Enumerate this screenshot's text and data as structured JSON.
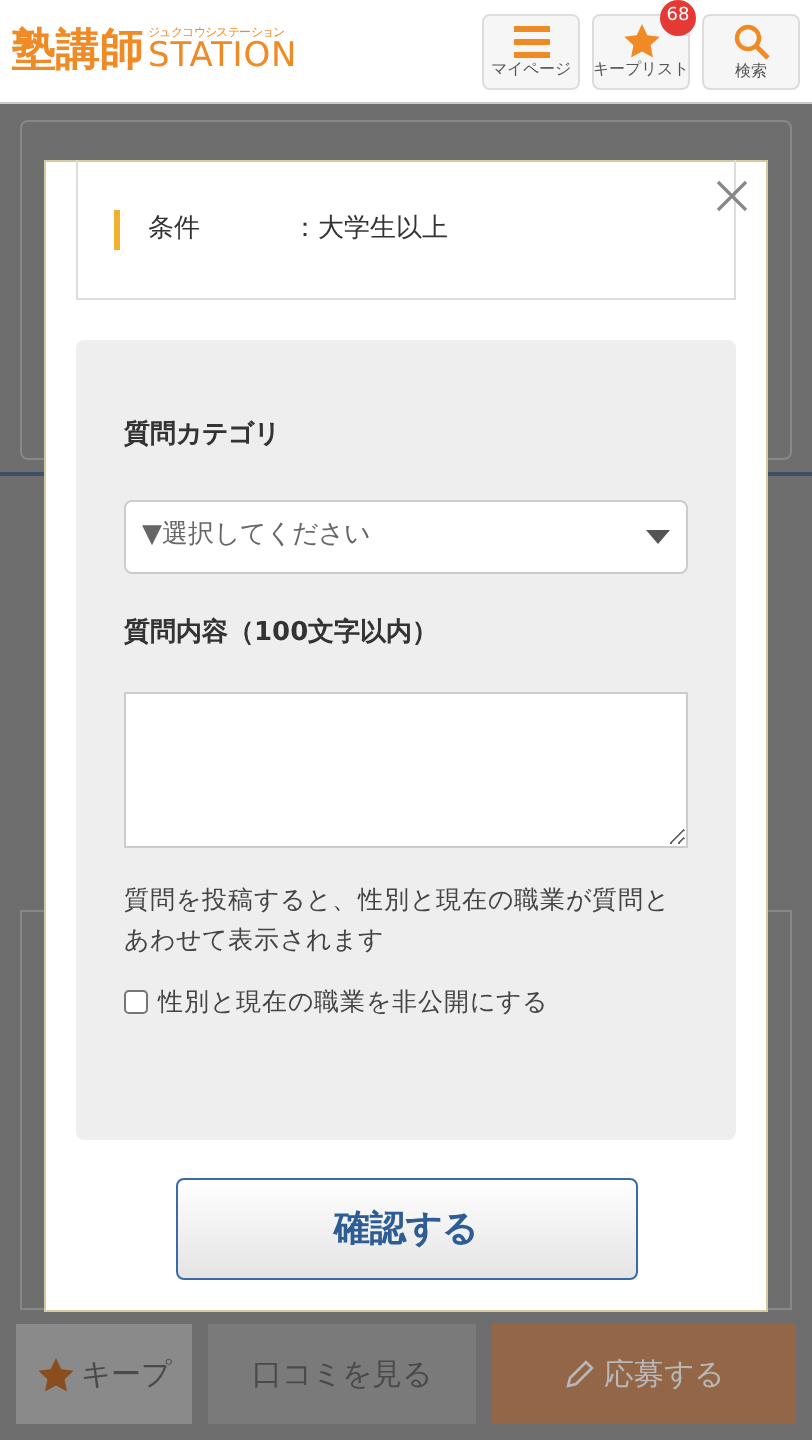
{
  "header": {
    "logo": "塾講師",
    "logo_sub": "STATION",
    "logo_ruby": "ジュクコウシステーション",
    "buttons": [
      {
        "kind": "menu",
        "label": "マイページ"
      },
      {
        "kind": "star",
        "label": "キープリスト",
        "badge": "68"
      },
      {
        "kind": "search",
        "label": "検索"
      }
    ]
  },
  "modal": {
    "condition": {
      "label": "条件",
      "value": "：大学生以上"
    },
    "category": {
      "label": "質問カテゴリ",
      "placeholder": "▼選択してください"
    },
    "content": {
      "label": "質問内容（100文字以内）"
    },
    "notice": "質問を投稿すると、性別と現在の職業が質問とあわせて表示されます",
    "hide_option": {
      "label": "性別と現在の職業を非公開にする",
      "checked": false
    },
    "confirm": "確認する"
  },
  "bottom_bar": [
    {
      "kind": "keep",
      "label": "キープ"
    },
    {
      "kind": "reviews",
      "label": "口コミを見る"
    },
    {
      "kind": "apply",
      "label": "応募する"
    }
  ]
}
